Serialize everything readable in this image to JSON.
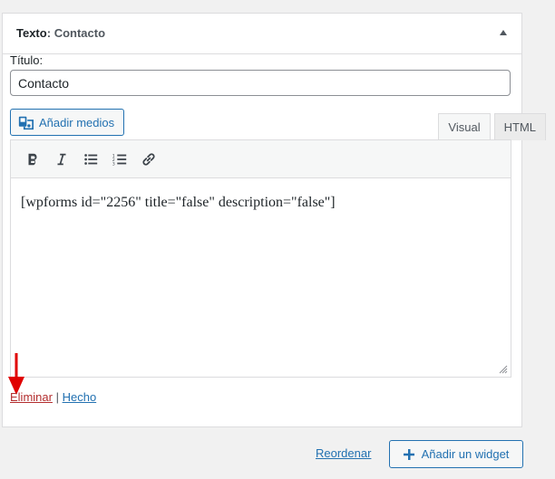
{
  "widget": {
    "type_label": "Texto",
    "separator": ":",
    "name": "Contacto"
  },
  "form": {
    "title_label": "Título:",
    "title_value": "Contacto"
  },
  "editor": {
    "add_media_label": "Añadir medios",
    "tabs": [
      {
        "label": "Visual",
        "active": true
      },
      {
        "label": "HTML",
        "active": false
      }
    ],
    "toolbar": [
      "bold-icon",
      "italic-icon",
      "bulleted-list-icon",
      "numbered-list-icon",
      "link-icon"
    ],
    "content": "[wpforms id=\"2256\" title=\"false\" description=\"false\"]"
  },
  "actions": {
    "delete_label": "Eliminar",
    "divider": "|",
    "done_label": "Hecho"
  },
  "footer": {
    "reorder_label": "Reordenar",
    "add_widget_label": "Añadir un widget"
  },
  "colors": {
    "accent": "#2271b1",
    "danger": "#b32d2e",
    "annotation_arrow": "#e00000"
  }
}
